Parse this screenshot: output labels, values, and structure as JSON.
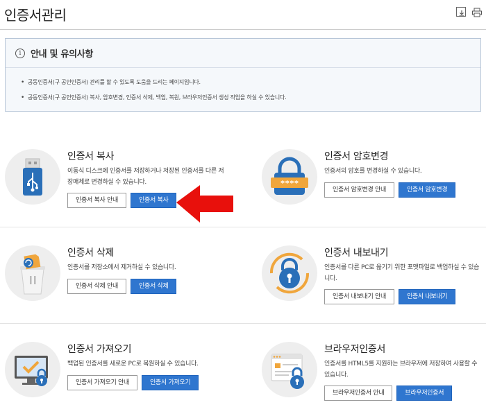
{
  "page": {
    "title": "인증서관리"
  },
  "toolbar": {
    "icons": [
      "download-icon",
      "print-icon"
    ]
  },
  "notice": {
    "title": "안내 및 유의사항",
    "items": [
      "공동인증서(구 공인인증서) 관리를 할 수 있도록 도움을 드리는 페이지입니다.",
      "공동인증서(구 공인인증서) 복사, 암호변경, 인증서 삭제, 백업, 복원, 브라우저인증서 생성 작업을 하실 수 있습니다."
    ]
  },
  "cards": {
    "copy": {
      "title": "인증서 복사",
      "desc": "이동식 디스크에 인증서를 저장하거나 저장된 인증서를 다른 저장매체로 변경하실 수 있습니다.",
      "guide_label": "인증서 복사 안내",
      "action_label": "인증서 복사"
    },
    "password": {
      "title": "인증서 암호변경",
      "desc": "인증서의 암호를 변경하실 수 있습니다.",
      "guide_label": "인증서 암호변경 안내",
      "action_label": "인증서 암호변경",
      "mask_text": "****"
    },
    "delete": {
      "title": "인증서 삭제",
      "desc": "인증서를 저장소에서 제거하실 수 있습니다.",
      "guide_label": "인증서 삭제 안내",
      "action_label": "인증서 삭제"
    },
    "export": {
      "title": "인증서 내보내기",
      "desc": "인증서를 다른 PC로 옮기기 위한 포맷파일로 백업하실 수 있습니다.",
      "guide_label": "인증서 내보내기 안내",
      "action_label": "인증서 내보내기"
    },
    "import": {
      "title": "인증서 가져오기",
      "desc": "백업된 인증서를 새로운 PC로 복원하실 수 있습니다.",
      "guide_label": "인증서 가져오기 안내",
      "action_label": "인증서 가져오기"
    },
    "browser": {
      "title": "브라우저인증서",
      "desc": "인증서를 HTML5를 지원하는 브라우저에 저장하여 사용할 수 있습니다.",
      "guide_label": "브라우저인증서 안내",
      "action_label": "브라우저인증서"
    }
  },
  "colors": {
    "primary": "#2f76cf",
    "icon_blue": "#2a6fb8",
    "icon_orange": "#f0a63c",
    "arrow_red": "#e8100c",
    "circle_bg": "#eeeeee"
  }
}
